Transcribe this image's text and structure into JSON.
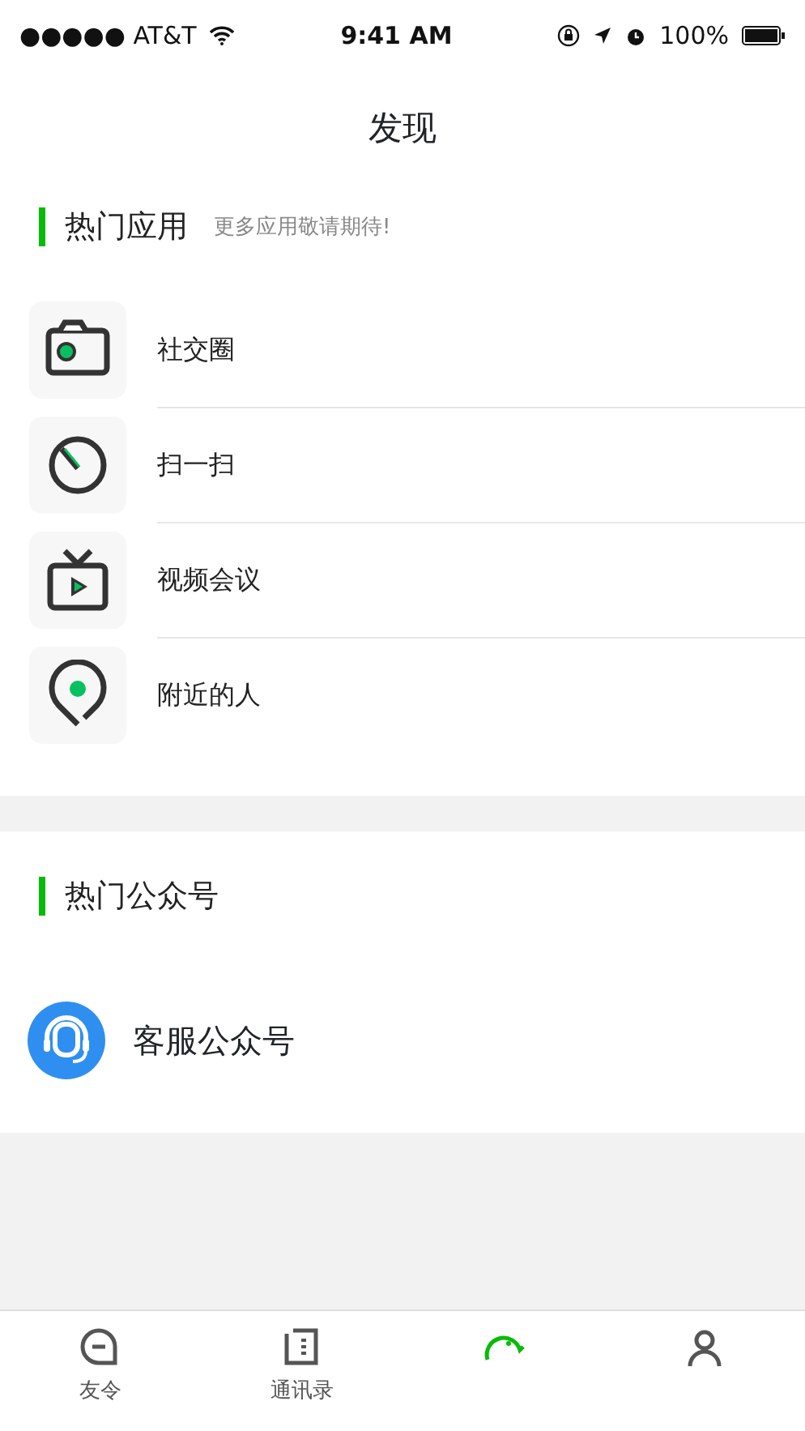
{
  "status_bar": {
    "carrier": "●●●●● AT&T",
    "time": "9:41 AM",
    "battery": "100%"
  },
  "title": "发现",
  "apps_section": {
    "title": "热门应用",
    "subtitle": "更多应用敬请期待!",
    "items": [
      {
        "kind": "camera",
        "label": "社交圈"
      },
      {
        "kind": "scan",
        "label": "扫一扫"
      },
      {
        "kind": "tv",
        "label": "视频会议"
      },
      {
        "kind": "pin",
        "label": "附近的人"
      }
    ]
  },
  "accounts_section": {
    "title": "热门公众号",
    "items": [
      {
        "kind": "service",
        "label": "客服公众号"
      }
    ]
  },
  "tab_bar": [
    {
      "kind": "chat",
      "label": "友令",
      "selected": false
    },
    {
      "kind": "contacts",
      "label": "通讯录",
      "selected": false
    },
    {
      "kind": "discover",
      "selected": true
    },
    {
      "kind": "me",
      "selected": false
    }
  ]
}
